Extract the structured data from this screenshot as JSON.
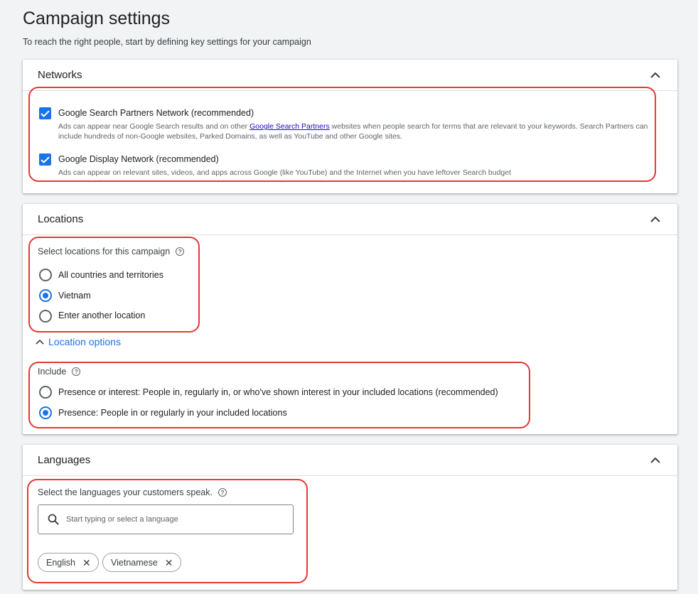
{
  "page": {
    "title": "Campaign settings",
    "subtitle": "To reach the right people, start by defining key settings for your campaign"
  },
  "networks": {
    "title": "Networks",
    "items": [
      {
        "label": "Google Search Partners Network (recommended)",
        "desc_before": "Ads can appear near Google Search results and on other ",
        "link": "Google Search Partners",
        "desc_after": " websites when people search for terms that are relevant to your keywords. Search Partners can include hundreds of non-Google websites, Parked Domains, as well as YouTube and other Google sites.",
        "checked": true
      },
      {
        "label": "Google Display Network (recommended)",
        "desc": "Ads can appear on relevant sites, videos, and apps across Google (like YouTube) and the Internet when you have leftover Search budget",
        "checked": true
      }
    ]
  },
  "locations": {
    "title": "Locations",
    "select_label": "Select locations for this campaign",
    "options": [
      {
        "label": "All countries and territories",
        "selected": false
      },
      {
        "label": "Vietnam",
        "selected": true
      },
      {
        "label": "Enter another location",
        "selected": false
      }
    ],
    "location_options_label": "Location options",
    "include_label": "Include",
    "include_options": [
      {
        "label": "Presence or interest: People in, regularly in, or who've shown interest in your included locations (recommended)",
        "selected": false
      },
      {
        "label": "Presence: People in or regularly in your included locations",
        "selected": true
      }
    ]
  },
  "languages": {
    "title": "Languages",
    "select_label": "Select the languages your customers speak.",
    "search_placeholder": "Start typing or select a language",
    "chips": [
      "English",
      "Vietnamese"
    ]
  },
  "icons": {
    "collapse": "chevron-up-icon",
    "help": "help-circle-icon",
    "search": "search-icon",
    "remove": "close-icon",
    "check": "check-icon"
  },
  "colors": {
    "accent": "#1a73e8",
    "highlight": "#e53935",
    "background": "#f1f3f4"
  }
}
